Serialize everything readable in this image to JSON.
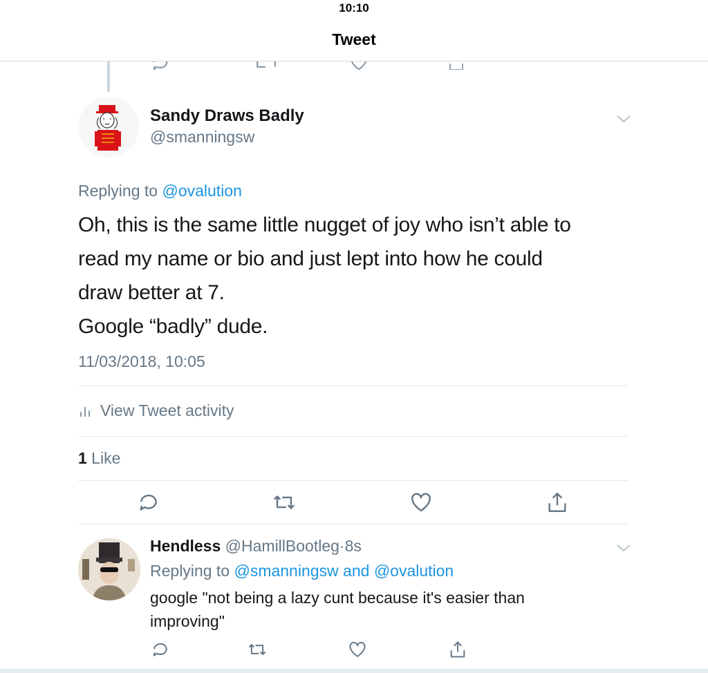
{
  "status": {
    "time": "10:10"
  },
  "nav": {
    "title": "Tweet"
  },
  "tweet": {
    "author_name": "Sandy Draws Badly",
    "author_handle": "@smanningsw",
    "replying_prefix": "Replying to ",
    "replying_to": "@ovalution",
    "text_lines": [
      "Oh, this is the same little nugget of joy who isn’t able to",
      "read my name or bio and just lept into how he could",
      "draw better at 7.",
      "Google “badly” dude."
    ],
    "timestamp": "11/03/2018, 10:05",
    "activity_label": "View Tweet activity",
    "like_count": "1",
    "like_label": " Like"
  },
  "reply": {
    "author_name": "Hendless",
    "author_handle": "@HamillBootleg",
    "separator": "·",
    "age": "8s",
    "replying_prefix": "Replying to ",
    "replying_to_1": "@smanningsw",
    "replying_and": " and ",
    "replying_to_2": "@ovalution",
    "text_lines": [
      "google \"not being a lazy cunt because it's easier than",
      "improving\""
    ]
  },
  "colors": {
    "link": "#1b95e0",
    "secondary_text": "#657786",
    "primary_text": "#14171a",
    "divider": "#e1e8ed"
  },
  "icons": [
    "reply-icon",
    "retweet-icon",
    "like-icon",
    "share-icon",
    "chevron-down-icon",
    "analytics-icon"
  ]
}
